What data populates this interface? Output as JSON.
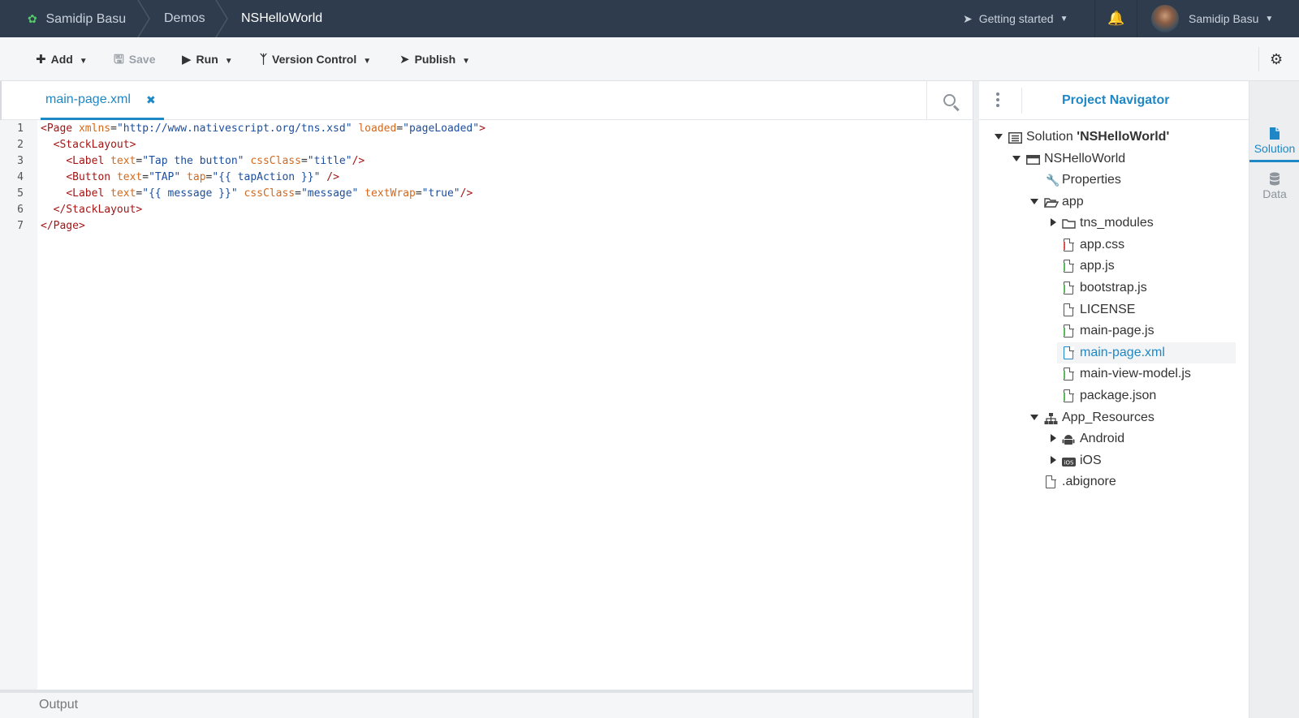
{
  "topbar": {
    "owner": "Samidip Basu",
    "breadcrumb_1": "Demos",
    "breadcrumb_2": "NSHelloWorld",
    "getting_started": "Getting started",
    "user_name": "Samidip Basu"
  },
  "toolbar": {
    "add": "Add",
    "save": "Save",
    "run": "Run",
    "version_control": "Version Control",
    "publish": "Publish"
  },
  "editor": {
    "tab_label": "main-page.xml",
    "line_numbers": [
      "1",
      "2",
      "3",
      "4",
      "5",
      "6",
      "7"
    ],
    "lines": [
      [
        [
          "tag",
          "<Page "
        ],
        [
          "attr",
          "xmlns"
        ],
        [
          "p",
          "="
        ],
        [
          "val",
          "\"http://www.nativescript.org/tns.xsd\""
        ],
        [
          "p",
          " "
        ],
        [
          "attr",
          "loaded"
        ],
        [
          "p",
          "="
        ],
        [
          "val",
          "\"pageLoaded\""
        ],
        [
          "tag",
          ">"
        ]
      ],
      [
        [
          "p",
          "  "
        ],
        [
          "tag",
          "<StackLayout>"
        ]
      ],
      [
        [
          "p",
          "    "
        ],
        [
          "tag",
          "<Label "
        ],
        [
          "attr",
          "text"
        ],
        [
          "p",
          "="
        ],
        [
          "val",
          "\"Tap the button\""
        ],
        [
          "p",
          " "
        ],
        [
          "attr",
          "cssClass"
        ],
        [
          "p",
          "="
        ],
        [
          "val",
          "\"title\""
        ],
        [
          "tag",
          "/>"
        ]
      ],
      [
        [
          "p",
          "    "
        ],
        [
          "tag",
          "<Button "
        ],
        [
          "attr",
          "text"
        ],
        [
          "p",
          "="
        ],
        [
          "val",
          "\"TAP\""
        ],
        [
          "p",
          " "
        ],
        [
          "attr",
          "tap"
        ],
        [
          "p",
          "="
        ],
        [
          "val",
          "\"{{ tapAction }}\""
        ],
        [
          "p",
          " "
        ],
        [
          "tag",
          "/>"
        ]
      ],
      [
        [
          "p",
          "    "
        ],
        [
          "tag",
          "<Label "
        ],
        [
          "attr",
          "text"
        ],
        [
          "p",
          "="
        ],
        [
          "val",
          "\"{{ message }}\""
        ],
        [
          "p",
          " "
        ],
        [
          "attr",
          "cssClass"
        ],
        [
          "p",
          "="
        ],
        [
          "val",
          "\"message\""
        ],
        [
          "p",
          " "
        ],
        [
          "attr",
          "textWrap"
        ],
        [
          "p",
          "="
        ],
        [
          "val",
          "\"true\""
        ],
        [
          "tag",
          "/>"
        ]
      ],
      [
        [
          "p",
          "  "
        ],
        [
          "tag",
          "</StackLayout>"
        ]
      ],
      [
        [
          "tag",
          "</Page>"
        ]
      ]
    ],
    "output_label": "Output"
  },
  "navigator": {
    "title": "Project Navigator",
    "solution_prefix": "Solution ",
    "solution_name": "'NSHelloWorld'",
    "items": [
      {
        "label": "NSHelloWorld",
        "icon": "project-icon",
        "expanded": true
      },
      {
        "label": "Properties",
        "icon": "wrench-icon"
      },
      {
        "label": "app",
        "icon": "folder-open-icon",
        "expanded": true
      },
      {
        "label": "tns_modules",
        "icon": "folder-icon",
        "expanded": false
      },
      {
        "label": "app.css",
        "icon": "css-file-icon"
      },
      {
        "label": "app.js",
        "icon": "js-file-icon"
      },
      {
        "label": "bootstrap.js",
        "icon": "js-file-icon"
      },
      {
        "label": "LICENSE",
        "icon": "file-icon"
      },
      {
        "label": "main-page.js",
        "icon": "js-file-icon"
      },
      {
        "label": "main-page.xml",
        "icon": "xml-file-icon",
        "selected": true
      },
      {
        "label": "main-view-model.js",
        "icon": "js-file-icon"
      },
      {
        "label": "package.json",
        "icon": "json-file-icon"
      },
      {
        "label": "App_Resources",
        "icon": "sitemap-icon",
        "expanded": true
      },
      {
        "label": "Android",
        "icon": "android-icon",
        "expanded": false
      },
      {
        "label": "iOS",
        "icon": "ios-icon",
        "expanded": false
      },
      {
        "label": ".abignore",
        "icon": "file-icon"
      }
    ]
  },
  "side_tabs": {
    "solution": "Solution",
    "data": "Data"
  },
  "colors": {
    "topbar": "#2f3c4d",
    "accent": "#1e88c7",
    "logo": "#55c96b",
    "xml_tag": "#a31515",
    "xml_attr": "#d2691e",
    "xml_value": "#1c4e9c"
  }
}
